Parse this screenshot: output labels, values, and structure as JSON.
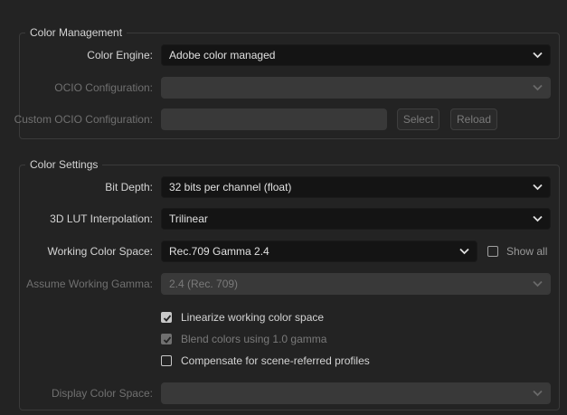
{
  "color_management": {
    "title": "Color Management",
    "color_engine": {
      "label": "Color Engine:",
      "value": "Adobe color managed"
    },
    "ocio_configuration": {
      "label": "OCIO Configuration:",
      "value": ""
    },
    "custom_ocio_configuration": {
      "label": "Custom OCIO Configuration:",
      "value": "",
      "select_label": "Select",
      "reload_label": "Reload"
    }
  },
  "color_settings": {
    "title": "Color Settings",
    "bit_depth": {
      "label": "Bit Depth:",
      "value": "32 bits per channel (float)"
    },
    "lut_interpolation": {
      "label": "3D LUT Interpolation:",
      "value": "Trilinear"
    },
    "working_color_space": {
      "label": "Working Color Space:",
      "value": "Rec.709 Gamma 2.4",
      "show_all_label": "Show all",
      "show_all_checked": false
    },
    "assume_working_gamma": {
      "label": "Assume Working Gamma:",
      "value": "2.4 (Rec. 709)"
    },
    "checkboxes": [
      {
        "label": "Linearize working color space",
        "checked": true,
        "enabled": true
      },
      {
        "label": "Blend colors using 1.0 gamma",
        "checked": true,
        "enabled": false
      },
      {
        "label": "Compensate for scene-referred profiles",
        "checked": false,
        "enabled": true
      }
    ],
    "display_color_space": {
      "label": "Display Color Space:",
      "value": ""
    }
  },
  "icons": {
    "dropdown": "chevron-down-icon",
    "check": "checkmark-icon"
  }
}
